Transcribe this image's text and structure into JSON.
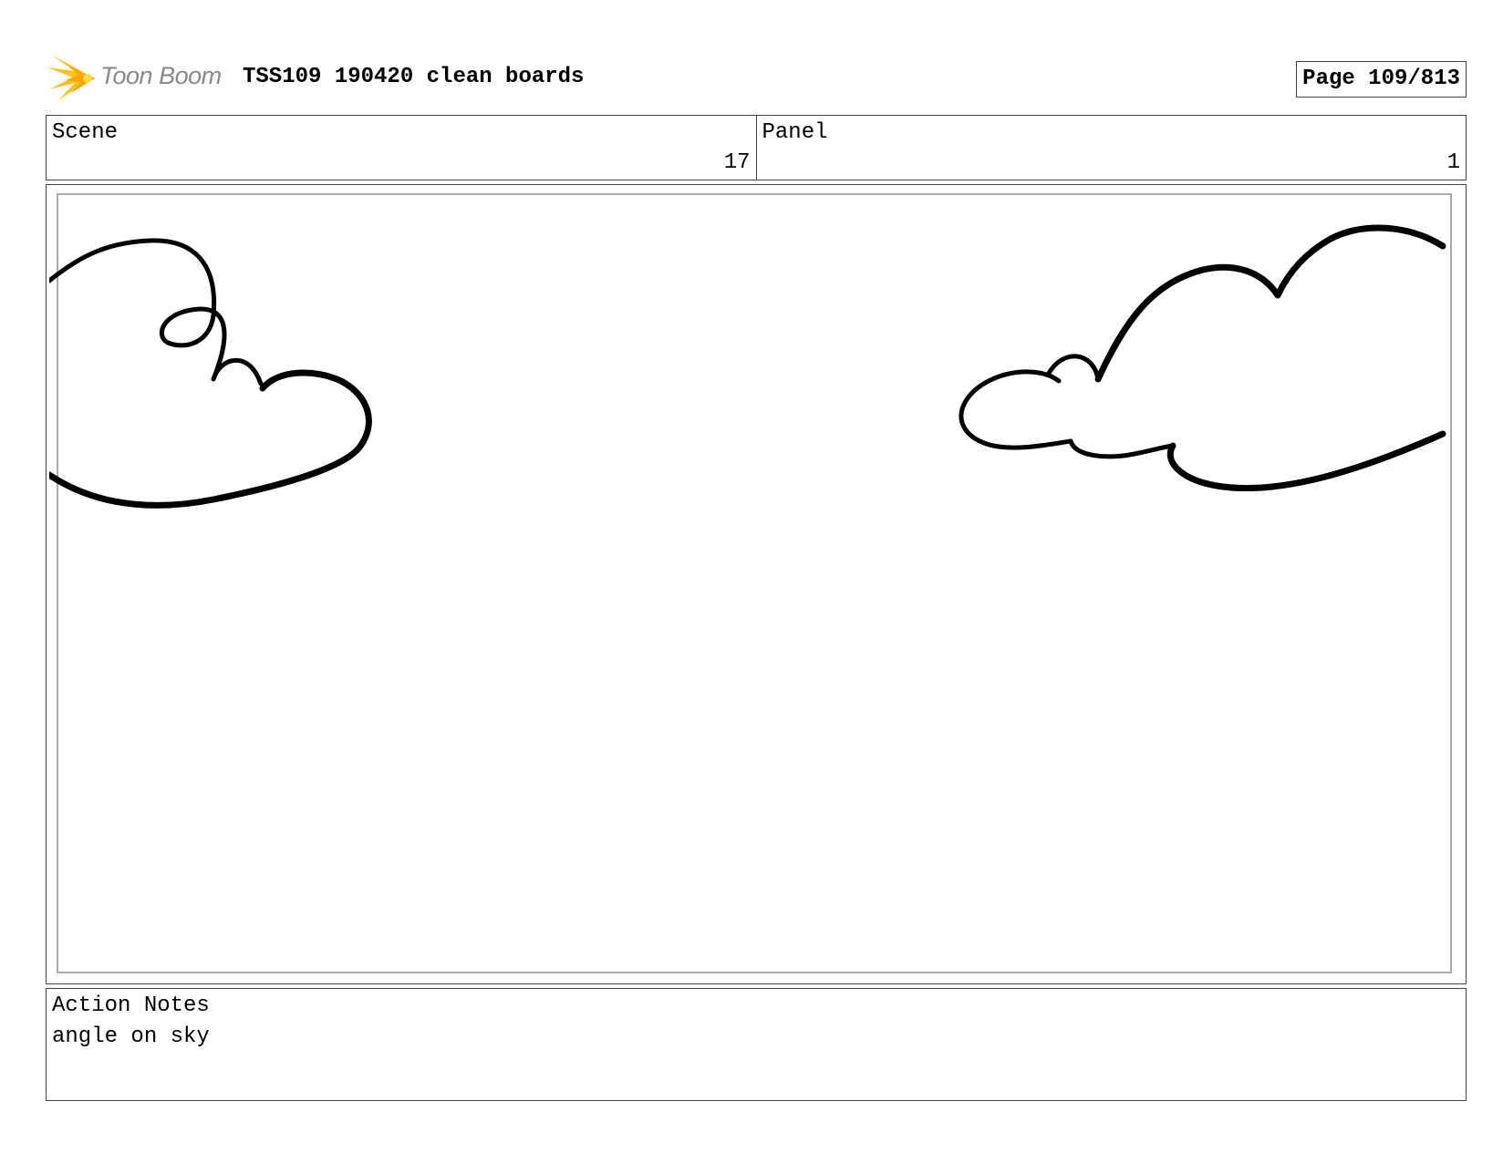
{
  "header": {
    "logo_text": "Toon Boom",
    "title": "TSS109 190420 clean boards",
    "page": "Page 109/813"
  },
  "info": {
    "scene_label": "Scene",
    "scene_value": "17",
    "panel_label": "Panel",
    "panel_value": "1"
  },
  "panel": {
    "content": "clouds-sketch"
  },
  "notes": {
    "label": "Action Notes",
    "text": "angle on sky"
  },
  "colors": {
    "logo_yellow": "#f6c21c",
    "logo_text": "#8a8a8a",
    "border": "#444444",
    "inner_frame": "#aaaaaa"
  }
}
